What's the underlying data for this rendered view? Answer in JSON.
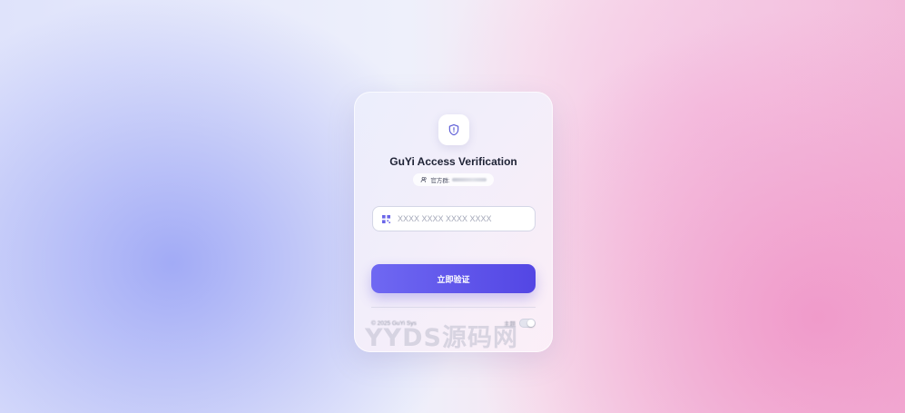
{
  "card": {
    "title": "GuYi Access Verification",
    "group_label": "官方群:",
    "input": {
      "placeholder": "XXXX XXXX XXXX XXXX",
      "value": ""
    },
    "submit_label": "立即验证",
    "footer": {
      "copyright": "© 2025 GuYi Sys",
      "toggle_label": "主题",
      "toggle_on": false
    }
  },
  "colors": {
    "accent_start": "#6f68f2",
    "accent_end": "#5346e4",
    "title": "#1e2235",
    "icon": "#5b5bd6"
  },
  "icons": {
    "logo": "shield-icon",
    "group": "users-icon",
    "input": "qr-code-icon"
  },
  "watermark": "YYDS源码网"
}
